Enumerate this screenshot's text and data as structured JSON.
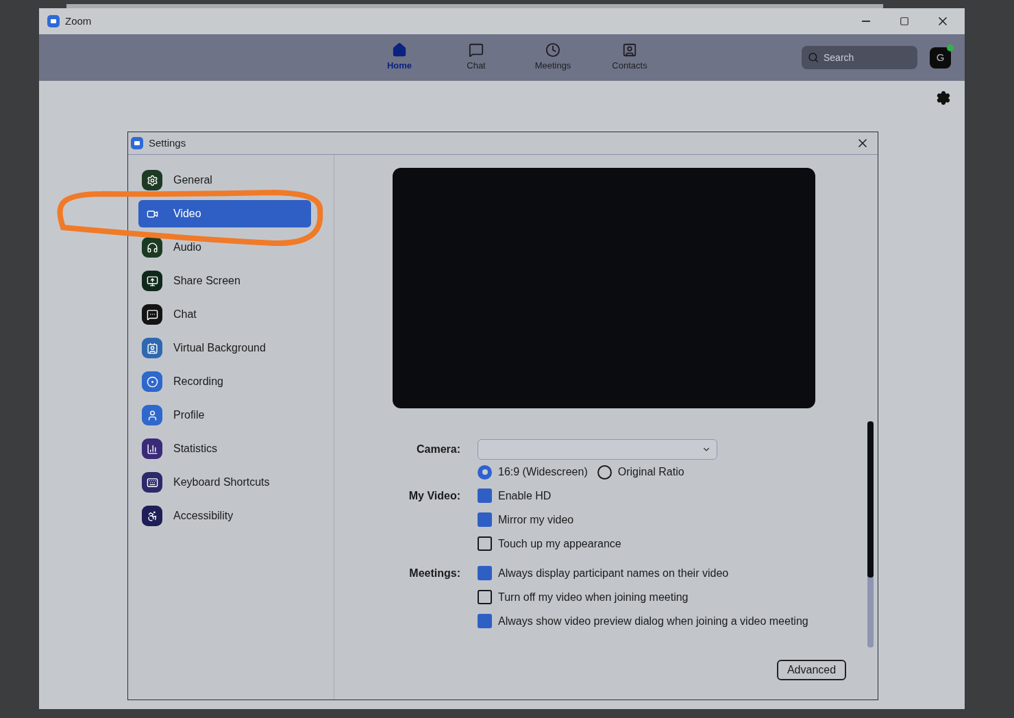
{
  "window": {
    "title": "Zoom"
  },
  "nav": [
    {
      "label": "Home",
      "selected": true
    },
    {
      "label": "Chat",
      "selected": false
    },
    {
      "label": "Meetings",
      "selected": false
    },
    {
      "label": "Contacts",
      "selected": false
    }
  ],
  "search": {
    "placeholder": "Search"
  },
  "avatar": {
    "initial": "G",
    "online": true
  },
  "settings": {
    "title": "Settings",
    "sidebar": [
      {
        "label": "General",
        "selected": false,
        "color": "#1f3a24"
      },
      {
        "label": "Video",
        "selected": true,
        "color": "#2f5fc4"
      },
      {
        "label": "Audio",
        "selected": false,
        "color": "#1c3a22"
      },
      {
        "label": "Share Screen",
        "selected": false,
        "color": "#10281a"
      },
      {
        "label": "Chat",
        "selected": false,
        "color": "#141414"
      },
      {
        "label": "Virtual Background",
        "selected": false,
        "color": "#2f68b0"
      },
      {
        "label": "Recording",
        "selected": false,
        "color": "#2f68cc"
      },
      {
        "label": "Profile",
        "selected": false,
        "color": "#2f68cc"
      },
      {
        "label": "Statistics",
        "selected": false,
        "color": "#3a2a78"
      },
      {
        "label": "Keyboard Shortcuts",
        "selected": false,
        "color": "#2c2a6a"
      },
      {
        "label": "Accessibility",
        "selected": false,
        "color": "#1e1e58"
      }
    ],
    "camera": {
      "label": "Camera:"
    },
    "aspect": [
      {
        "label": "16:9 (Widescreen)",
        "selected": true
      },
      {
        "label": "Original Ratio",
        "selected": false
      }
    ],
    "groups": [
      {
        "label": "My Video:",
        "options": [
          {
            "label": "Enable HD",
            "checked": true
          },
          {
            "label": "Mirror my video",
            "checked": true
          },
          {
            "label": "Touch up my appearance",
            "checked": false
          }
        ]
      },
      {
        "label": "Meetings:",
        "options": [
          {
            "label": "Always display participant names on their video",
            "checked": true
          },
          {
            "label": "Turn off my video when joining meeting",
            "checked": false
          },
          {
            "label": "Always show video preview dialog when joining a video meeting",
            "checked": true
          }
        ]
      }
    ],
    "advanced": "Advanced"
  }
}
